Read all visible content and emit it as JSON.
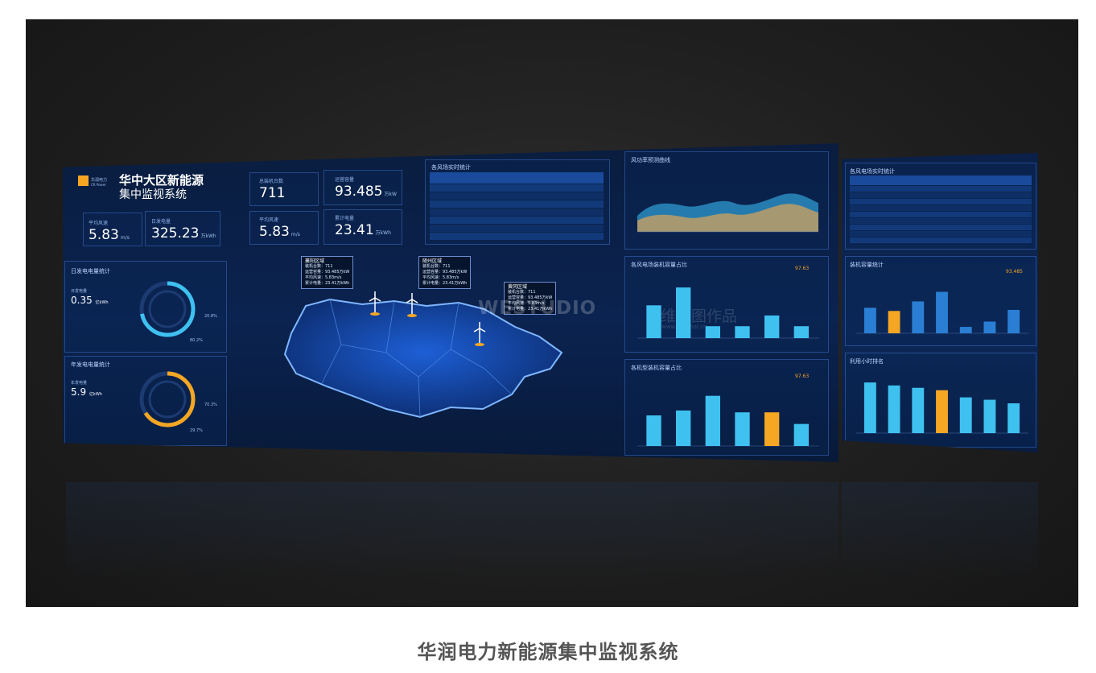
{
  "caption": "华润电力新能源集中监视系统",
  "header": {
    "logo_text": "华润电力",
    "logo_sub": "CR Power",
    "title_line1": "华中大区新能源",
    "title_line2": "集中监视系统"
  },
  "kpis": [
    {
      "label": "总装机台数",
      "value": "711",
      "unit": ""
    },
    {
      "label": "运营容量",
      "value": "93.485",
      "unit": "万kW"
    },
    {
      "label": "平均风速",
      "value": "5.83",
      "unit": "m/s"
    },
    {
      "label": "累计电量",
      "value": "23.41",
      "unit": "万kWh"
    },
    {
      "label": "平均风速",
      "value": "5.83",
      "unit": "m/s"
    },
    {
      "label": "日发电量",
      "value": "325.23",
      "unit": "万kWh"
    }
  ],
  "left_panels": {
    "daily": {
      "title": "日发电电量统计",
      "label": "日发电量",
      "value": "0.35",
      "unit": "亿kWh",
      "pct_a": "20.8%",
      "pct_b": "80.2%",
      "level": 0.72
    },
    "yearly": {
      "title": "年发电电量统计",
      "label": "年发电量",
      "value": "5.9",
      "unit": "亿kWh",
      "pct_a": "70.3%",
      "pct_b": "29.7%",
      "level": 0.66
    }
  },
  "map": {
    "regions": [
      {
        "title": "襄阳区域",
        "lines": [
          "装机台数：711",
          "运营容量：93.485万kW",
          "平均风速：5.83m/s",
          "累计电量：23.41万kWh"
        ]
      },
      {
        "title": "随州区域",
        "lines": [
          "装机台数：711",
          "运营容量：93.485万kW",
          "平均风速：5.83m/s",
          "累计电量：23.41万kWh"
        ]
      },
      {
        "title": "黄冈区域",
        "lines": [
          "装机台数：711",
          "运营容量：93.485万kW",
          "平均风速：5.83m/s",
          "累计电量：23.41万kWh"
        ]
      }
    ]
  },
  "watermark": {
    "logo": "WESTUDIO",
    "cn": "万维思图作品",
    "url": "www.cn-wbai.cn"
  },
  "table_panel": {
    "title": "各风场实时统计"
  },
  "charts": {
    "wind_curve": {
      "title": "风功率预测曲线"
    },
    "bar_mid1": {
      "title": "各风电场装机容量占比",
      "highlight": "97.63"
    },
    "bar_mid2": {
      "title": "各机型装机容量占比",
      "highlight": "97.63"
    },
    "right_table": {
      "title": "各风电场实时统计"
    },
    "right_bar1": {
      "title": "装机容量统计",
      "highlight": "93.485"
    },
    "right_bar2": {
      "title": "利用小时排名"
    }
  },
  "colors": {
    "accent_blue": "#3fc1f0",
    "accent_orange": "#f5a623",
    "screen_bg": "#0b2350"
  }
}
